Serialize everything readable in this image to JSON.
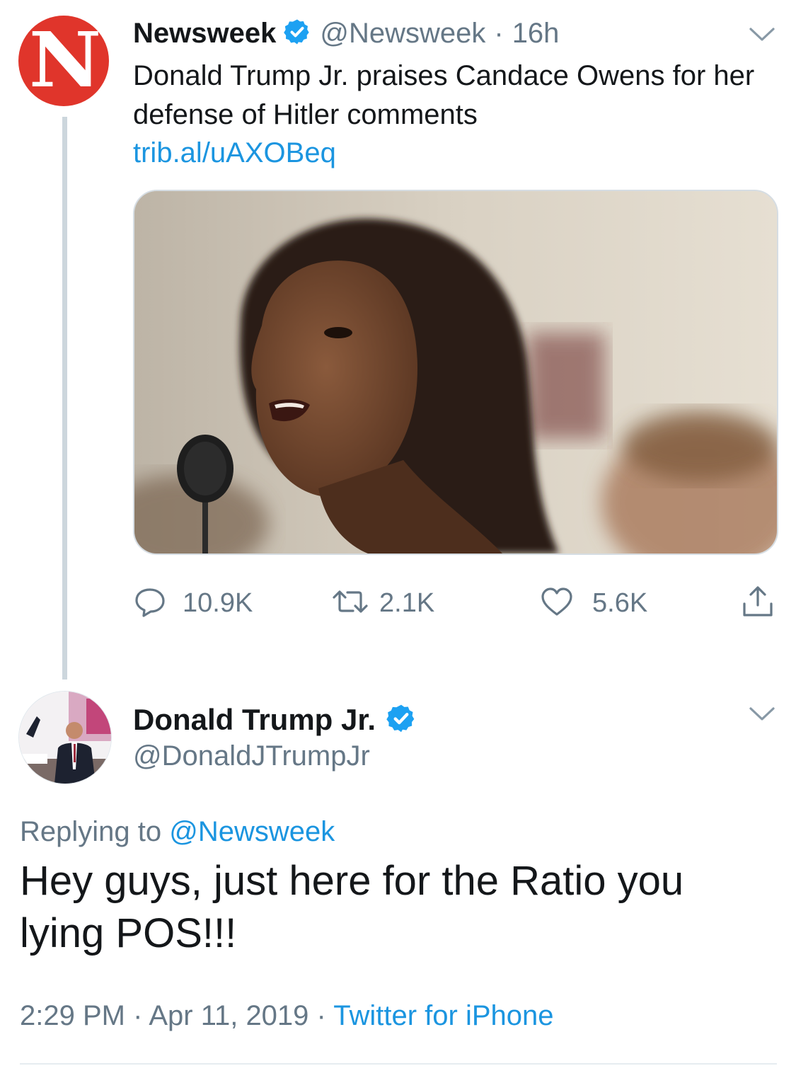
{
  "colors": {
    "link": "#1b95e0",
    "secondary_text": "#657786",
    "primary_text": "#14171a",
    "verified_badge": "#1da1f2",
    "newsweek_brand": "#e0352b"
  },
  "tweet1": {
    "avatar_icon": "newsweek-logo-icon",
    "avatar_letter": "N",
    "name": "Newsweek",
    "verified_icon": "verified-badge-icon",
    "handle": "@Newsweek",
    "separator": "·",
    "time": "16h",
    "text": "Donald Trump Jr. praises Candace Owens for her defense of Hitler comments",
    "link": "trib.al/uAXOBeq",
    "actions": {
      "reply_count": "10.9K",
      "retweet_count": "2.1K",
      "like_count": "5.6K"
    }
  },
  "tweet2": {
    "name": "Donald Trump Jr.",
    "handle": "@DonaldJTrumpJr",
    "replying_prefix": "Replying to",
    "replying_to": "@Newsweek",
    "text": "Hey guys, just here for the Ratio you lying POS!!!",
    "time": "2:29 PM",
    "date": "Apr 11, 2019",
    "separator": "·",
    "source": "Twitter for iPhone"
  }
}
